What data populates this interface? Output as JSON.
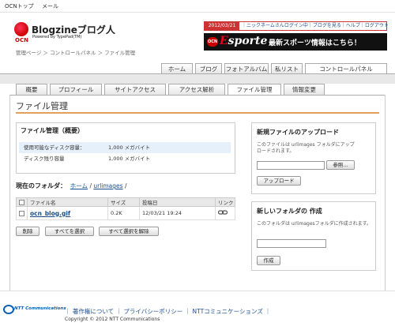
{
  "topbar": {
    "ocn_top": "OCNトップ",
    "mail": "メール"
  },
  "logo": {
    "ocn": "OCN",
    "title": "Blogzineブログ人",
    "subtitle": "Powered by TypePad(TM)"
  },
  "userlinks": {
    "date": "2012/03/21",
    "text": "｜ニックネームさんログイン中｜ブログを見る｜ヘルプ｜ログアウト"
  },
  "banner": {
    "ocn": "OCN",
    "brand_e": "E",
    "brand_rest": "sporte",
    "message": "最新スポーツ情報はこちら！"
  },
  "breadcrumb": "管理ページ ＞ コントロールパネル ＞ ファイル管理",
  "main_nav": [
    "ホーム",
    "ブログ",
    "フォトアルバム",
    "私リスト",
    "コントロールパネル"
  ],
  "sub_tabs": [
    "概要",
    "プロフィール",
    "サイトアクセス",
    "アクセス解析",
    "ファイル管理",
    "情報変更"
  ],
  "page_title": "ファイル管理",
  "summary": {
    "header": "ファイル管理（概要）",
    "rows": [
      {
        "label": "使用可能なディスク容量：",
        "value": "1,000 メガバイト"
      },
      {
        "label": "ディスク残り容量",
        "value": "1,000 メガバイト"
      }
    ]
  },
  "current_folder": {
    "label": "現在のフォルダ：",
    "home": "ホーム",
    "sep1": "/",
    "folder": "urlimages",
    "sep2": "/"
  },
  "file_table": {
    "headers": [
      "",
      "ファイル名",
      "サイズ",
      "投稿日",
      "リンク"
    ],
    "rows": [
      {
        "name": "ocn_blog.gif",
        "size": "0.2K",
        "date": "12/03/21 19:24"
      }
    ]
  },
  "actions": {
    "delete": "削除",
    "select_all": "すべてを選択",
    "deselect_all": "すべて選択を解除"
  },
  "upload": {
    "title": "新規ファイルのアップロード",
    "desc1": "このファイルは urlimages フォルダにアップ",
    "desc2": "ロードされます。",
    "browse": "参照...",
    "submit": "アップロード"
  },
  "newfolder": {
    "title": "新しいフォルダの 作成",
    "desc": "このフォルダは urlimagesフォルダに作成されます。",
    "submit": "作成"
  },
  "footer": {
    "logo": "NTT Communications",
    "links": "｜ 著作権について ｜ プライバシーポリシー ｜ NTTコミュニケーションズ ｜",
    "copyright": "Copyright © 2012  NTT Communications"
  },
  "colors": {
    "accent": "#e2a05a",
    "link": "#1a4f8f",
    "brand_red": "#cc3333"
  }
}
